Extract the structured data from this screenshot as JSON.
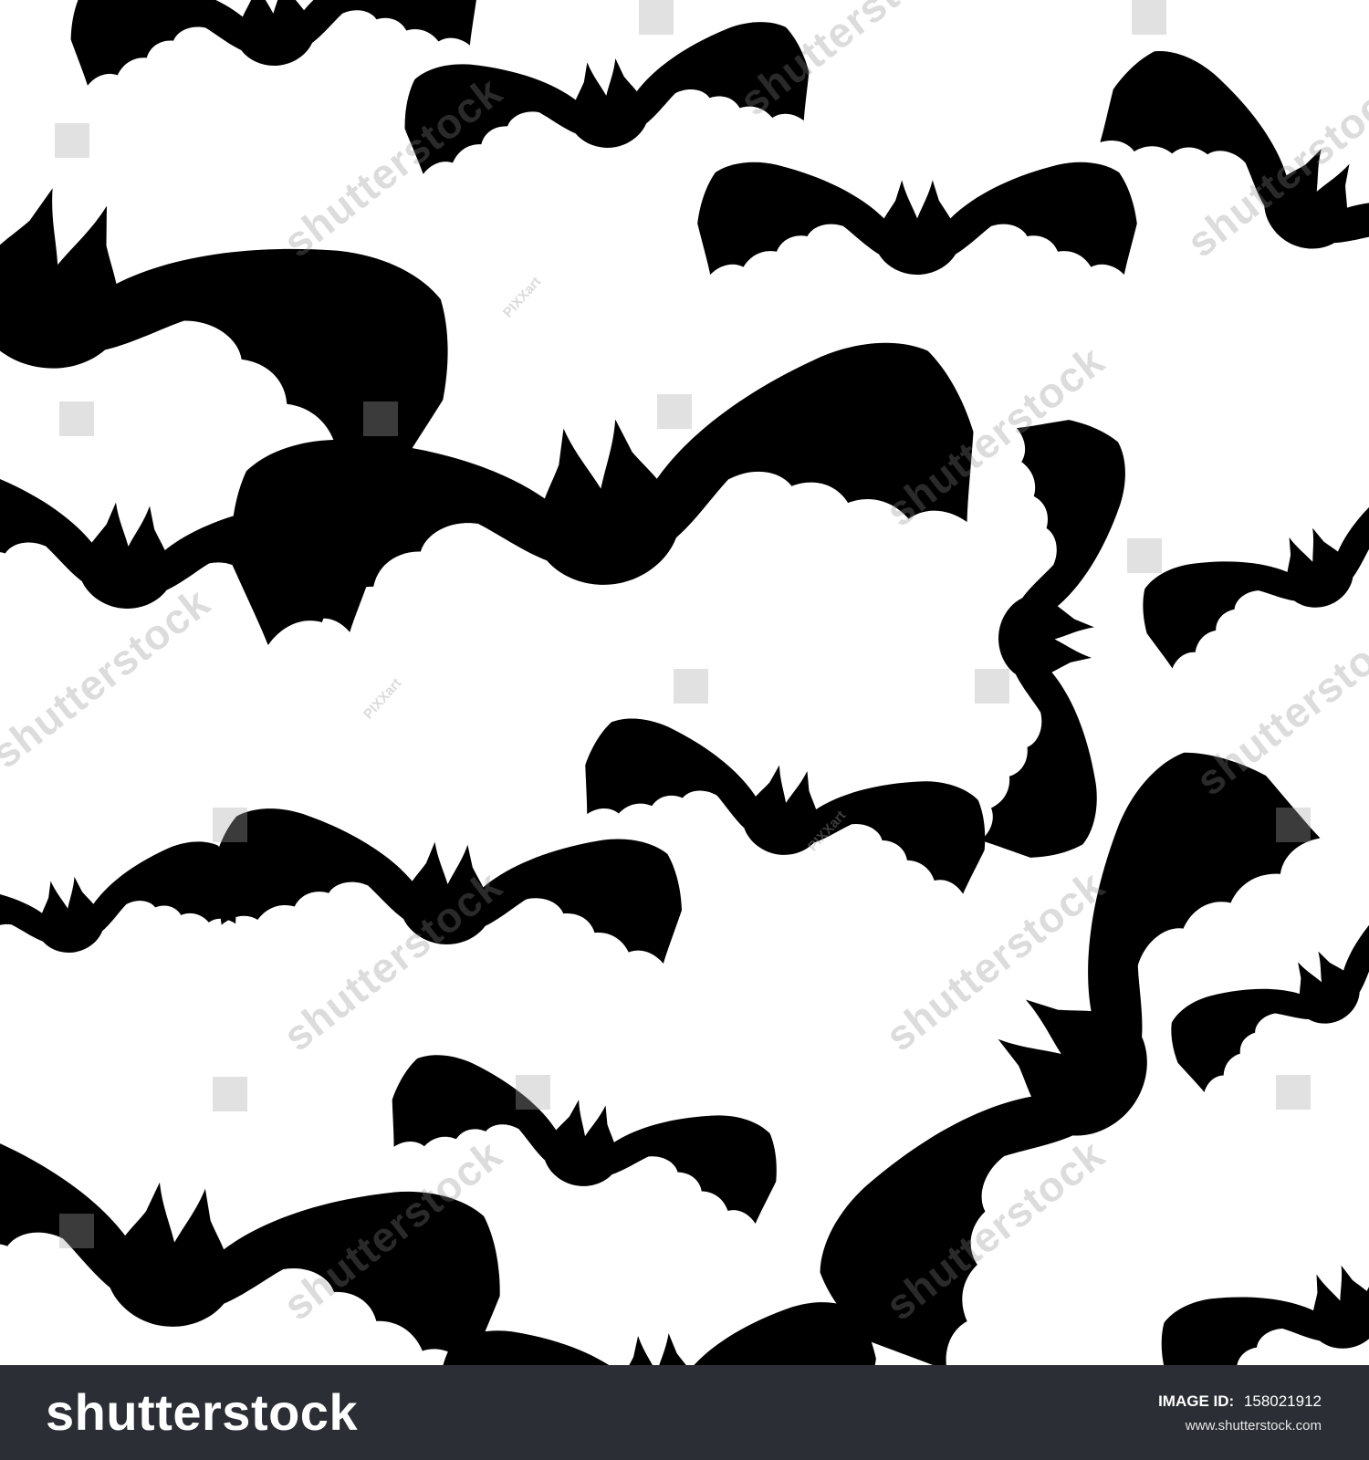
{
  "image": {
    "subject": "bat silhouettes",
    "background_color": "#ffffff",
    "silhouette_color": "#000000"
  },
  "watermark": {
    "brand_mark": "shutterstock",
    "author_mark": "PIXXart"
  },
  "footer": {
    "background_color": "#2b2e35",
    "brand": "shutterstock",
    "image_id_label": "IMAGE ID:",
    "image_id_value": "158021912",
    "website": "www.shutterstock.com"
  }
}
